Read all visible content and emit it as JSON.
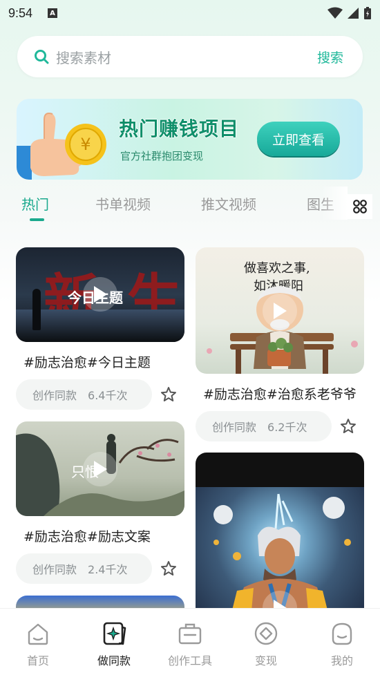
{
  "status_bar": {
    "time": "9:54",
    "notif_icon": "A"
  },
  "search": {
    "placeholder": "搜索素材",
    "button": "搜索"
  },
  "banner": {
    "title": "热门赚钱项目",
    "subtitle": "官方社群抱团变现",
    "button": "立即查看",
    "coin_symbol": "¥"
  },
  "tabs": [
    {
      "label": "热门",
      "active": true
    },
    {
      "label": "书单视频",
      "active": false
    },
    {
      "label": "推文视频",
      "active": false
    },
    {
      "label": "图生",
      "active": false
    }
  ],
  "cards": [
    {
      "title": "#励志治愈#今日主题",
      "action": "创作同款",
      "uses": "6.4千次",
      "overlay": "今日主题",
      "big_text": "新生"
    },
    {
      "title": "#励志治愈#治愈系老爷爷",
      "action": "创作同款",
      "uses": "6.2千次",
      "overlay_line1": "做喜欢之事,",
      "overlay_line2": "如沐暖阳"
    },
    {
      "title": "#励志治愈#励志文案",
      "action": "创作同款",
      "uses": "2.4千次",
      "overlay": "只恨"
    },
    {
      "title": "",
      "action": "",
      "uses": ""
    }
  ],
  "bottom_nav": [
    {
      "label": "首页",
      "icon": "home-icon",
      "active": false
    },
    {
      "label": "做同款",
      "icon": "make-same-icon",
      "active": true
    },
    {
      "label": "创作工具",
      "icon": "toolbox-icon",
      "active": false
    },
    {
      "label": "变现",
      "icon": "monetize-icon",
      "active": false
    },
    {
      "label": "我的",
      "icon": "profile-icon",
      "active": false
    }
  ],
  "colors": {
    "accent": "#1aa98d",
    "text": "#222222",
    "muted": "#9a9a9a"
  }
}
